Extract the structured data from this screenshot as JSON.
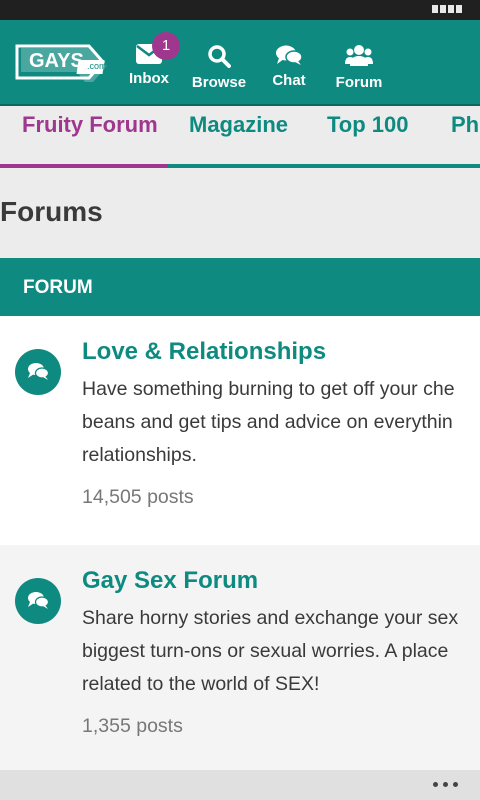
{
  "header": {
    "logo_text": "GAYS",
    "logo_sub": ".com",
    "nav": [
      {
        "label": "Inbox",
        "icon": "envelope-icon",
        "badge": "1"
      },
      {
        "label": "Browse",
        "icon": "search-icon"
      },
      {
        "label": "Chat",
        "icon": "chat-bubbles-icon"
      },
      {
        "label": "Forum",
        "icon": "users-group-icon"
      }
    ]
  },
  "tabs": [
    {
      "label": "Fruity Forum",
      "active": true
    },
    {
      "label": "Magazine",
      "active": false
    },
    {
      "label": "Top 100",
      "active": false
    },
    {
      "label": "Pho",
      "active": false
    }
  ],
  "page": {
    "title": "Forums",
    "section_header": "FORUM"
  },
  "forums": [
    {
      "title": "Love & Relationships",
      "description": "Have something burning to get off your chest? Spill the beans and get tips and advice on everything about relationships.",
      "desc_lines": [
        "Have something burning to get off your che",
        "beans and get tips and advice on everythin",
        "relationships."
      ],
      "posts_count": "14,505",
      "posts_label": "posts"
    },
    {
      "title": "Gay Sex Forum",
      "description": "Share horny stories and exchange your sex biggest turn-ons or sexual worries. A place related to the world of SEX!",
      "desc_lines": [
        "Share horny stories and exchange your sex",
        "biggest turn-ons or sexual worries.  A place",
        "related to the world of SEX!"
      ],
      "posts_count": "1,355",
      "posts_label": "posts"
    }
  ],
  "colors": {
    "brand_teal": "#0e8a80",
    "accent_purple": "#a0378e",
    "text_dark": "#3a3a3a",
    "text_muted": "#777777"
  }
}
